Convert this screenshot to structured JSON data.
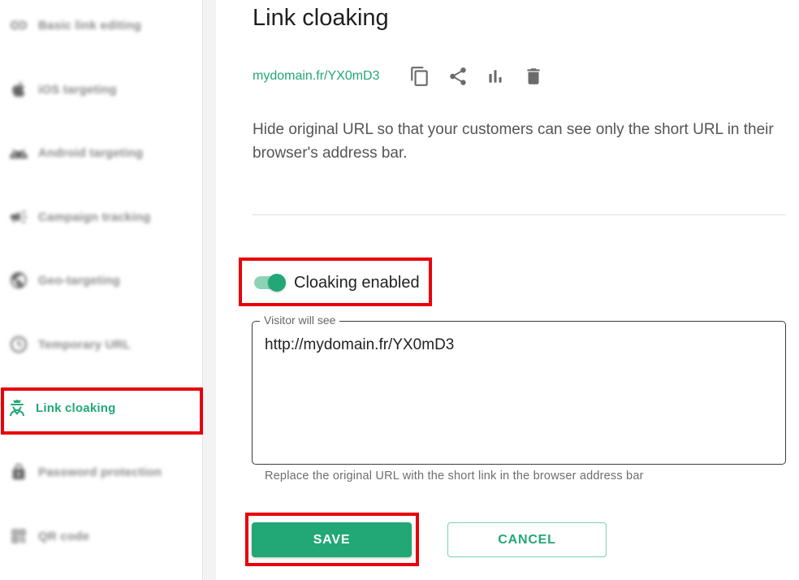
{
  "sidebar": {
    "items": [
      {
        "label": "Basic link editing",
        "icon": "link-icon"
      },
      {
        "label": "iOS targeting",
        "icon": "apple-icon"
      },
      {
        "label": "Android targeting",
        "icon": "android-icon"
      },
      {
        "label": "Campaign tracking",
        "icon": "megaphone-icon"
      },
      {
        "label": "Geo-targeting",
        "icon": "globe-icon"
      },
      {
        "label": "Temporary URL",
        "icon": "clock-icon"
      },
      {
        "label": "Link cloaking",
        "icon": "spy-icon",
        "active": true
      },
      {
        "label": "Password protection",
        "icon": "lock-icon"
      },
      {
        "label": "QR code",
        "icon": "qr-code-icon"
      }
    ]
  },
  "main": {
    "title": "Link cloaking",
    "short_link": "mydomain.fr/YX0mD3",
    "toolbar_icons": [
      "copy-icon",
      "share-icon",
      "bar-chart-icon",
      "trash-icon"
    ],
    "description": "Hide original URL so that your customers can see only the short URL in their browser's address bar.",
    "toggle": {
      "label": "Cloaking enabled",
      "checked": true
    },
    "field": {
      "legend": "Visitor will see",
      "value": "http://mydomain.fr/YX0mD3",
      "helper": "Replace the original URL with the short link in the browser address bar"
    },
    "buttons": {
      "save": "SAVE",
      "cancel": "CANCEL"
    }
  },
  "colors": {
    "accent": "#22a876",
    "highlight": "#e8000b",
    "toggle_track": "#8fd3b6"
  }
}
